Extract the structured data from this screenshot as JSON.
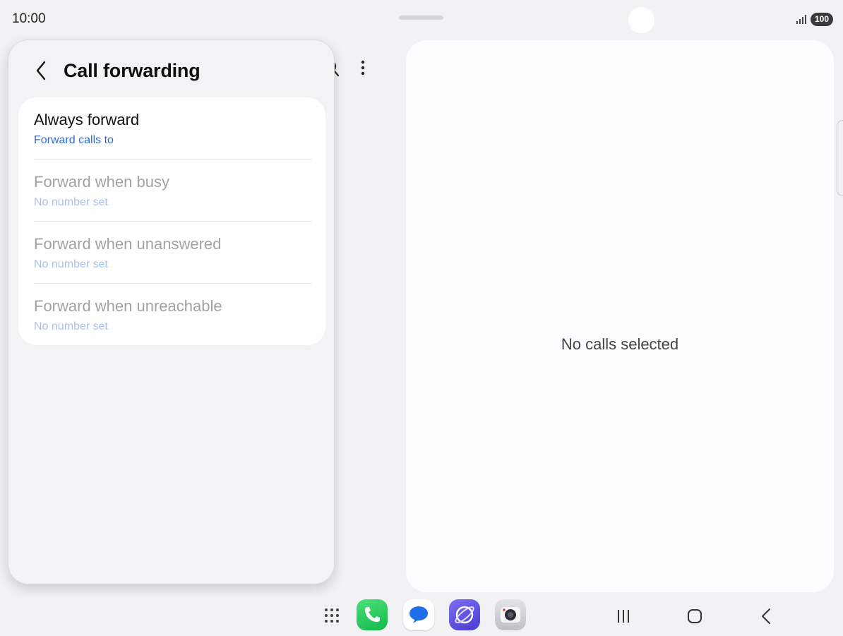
{
  "status_bar": {
    "time": "10:00",
    "battery": "100"
  },
  "popup": {
    "title": "Call forwarding",
    "items": [
      {
        "title": "Always forward",
        "subtitle": "Forward calls to",
        "enabled": true
      },
      {
        "title": "Forward when busy",
        "subtitle": "No number set",
        "enabled": false
      },
      {
        "title": "Forward when unanswered",
        "subtitle": "No number set",
        "enabled": false
      },
      {
        "title": "Forward when unreachable",
        "subtitle": "No number set",
        "enabled": false
      }
    ]
  },
  "detail": {
    "empty_text": "No calls selected"
  },
  "taskbar": {
    "apps": [
      "phone-app-icon",
      "messages-app-icon",
      "internet-app-icon",
      "camera-app-icon"
    ],
    "nav": [
      "recents-icon",
      "home-icon",
      "back-icon"
    ]
  },
  "colors": {
    "accent": "#2e6bd8",
    "disabled_subtitle": "#a8c3e8",
    "disabled_title": "#a2a2a6"
  }
}
